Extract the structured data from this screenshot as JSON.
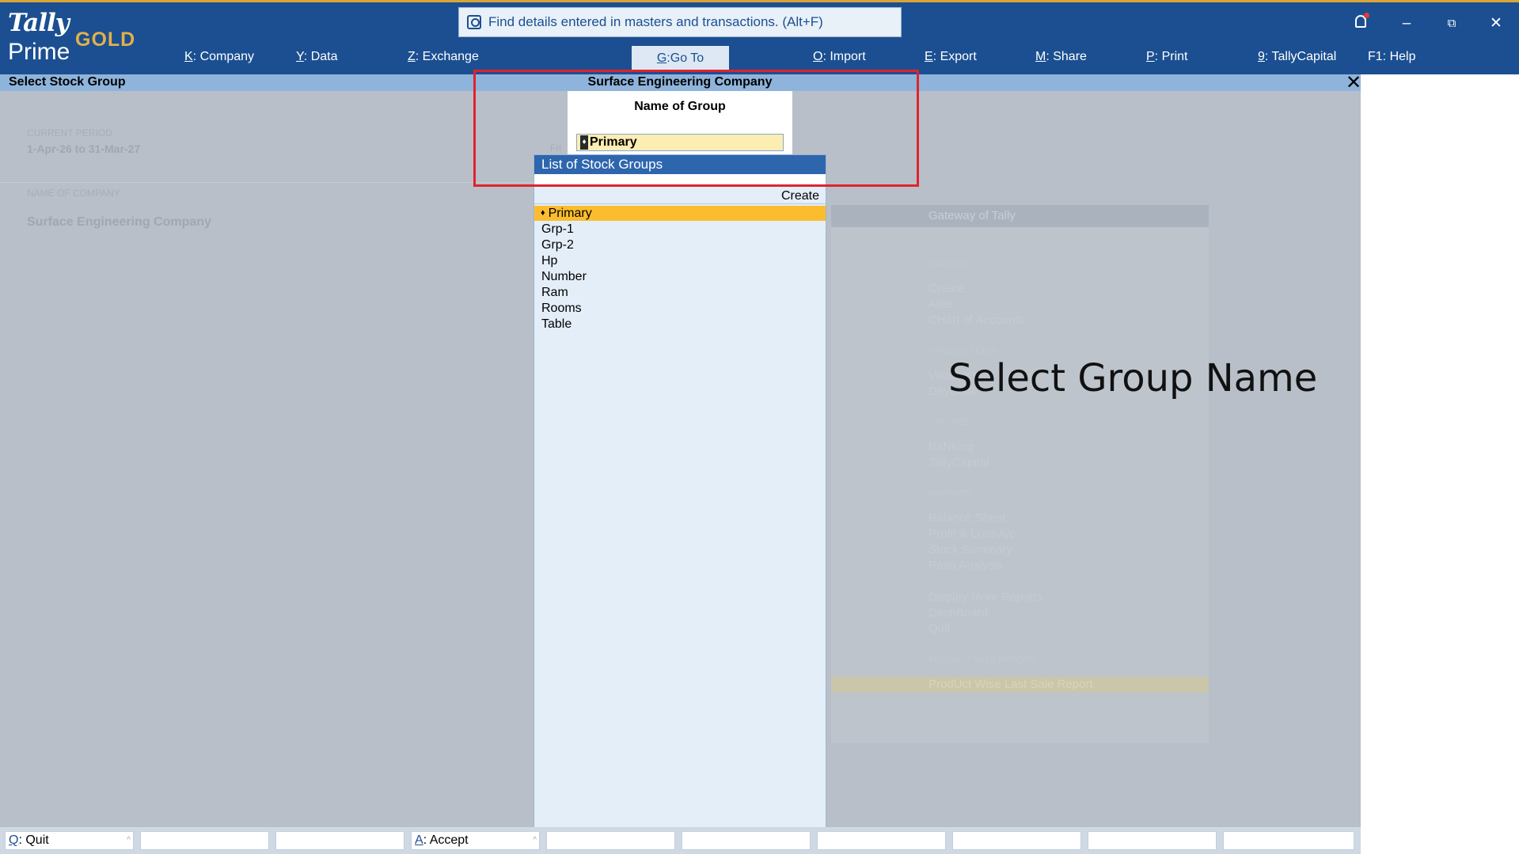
{
  "app": {
    "logo_tally": "Tally",
    "logo_prime": "Prime",
    "logo_edition": "GOLD"
  },
  "search": {
    "text": "Find details entered in masters and transactions. (Alt+F)"
  },
  "menu": [
    {
      "key": "K",
      "label": "Company"
    },
    {
      "key": "Y",
      "label": "Data"
    },
    {
      "key": "Z",
      "label": "Exchange"
    },
    {
      "key": "G",
      "label": "Go To"
    },
    {
      "key": "O",
      "label": "Import"
    },
    {
      "key": "E",
      "label": "Export"
    },
    {
      "key": "M",
      "label": "Share"
    },
    {
      "key": "P",
      "label": "Print"
    },
    {
      "key": "9",
      "label": "TallyCapital"
    },
    {
      "key": "F1",
      "label": "Help"
    }
  ],
  "title_bar": {
    "left": "Select Stock Group",
    "center": "Surface Engineering Company"
  },
  "background": {
    "current_period_label": "CURRENT PERIOD",
    "current_period_value": "1-Apr-26 to 31-Mar-27",
    "name_of_company_label": "NAME OF COMPANY",
    "company_name": "Surface Engineering Company",
    "partial_text": "Fri"
  },
  "gateway": {
    "title": "Gateway of Tally",
    "sections": [
      {
        "heading": "MASTERS",
        "items": [
          "Create",
          "Alter",
          "CHart of Accounts"
        ]
      },
      {
        "heading": "TRANSACTIONS",
        "items": [
          "Vouchers",
          "DayBook"
        ]
      },
      {
        "heading": "UTILITIES",
        "items": [
          "BaNking",
          "TallyCapital"
        ]
      },
      {
        "heading": "REPORTS",
        "items": [
          "Balance Sheet",
          "Profit & Loss A/c",
          "Stock Summary",
          "Ratio Analysis"
        ]
      },
      {
        "heading": "",
        "items": [
          "Display More Reports",
          "DashBoard",
          "Quit"
        ]
      },
      {
        "heading": "PRODUCT WISE REPORT",
        "items": []
      }
    ],
    "footer_item": "ProdUct Wise Last Sale Report"
  },
  "overlay_caption": "Select Group Name",
  "name_of_group": {
    "label": "Name of Group",
    "value": "Primary"
  },
  "stock_group_list": {
    "title": "List of Stock Groups",
    "create_label": "Create",
    "items": [
      "Primary",
      "Grp-1",
      "Grp-2",
      "Hp",
      "Number",
      "Ram",
      "Rooms",
      "Table"
    ],
    "selected": "Primary"
  },
  "bottom_bar": {
    "quit": {
      "key": "Q",
      "label": "Quit"
    },
    "accept": {
      "key": "A",
      "label": "Accept"
    }
  }
}
